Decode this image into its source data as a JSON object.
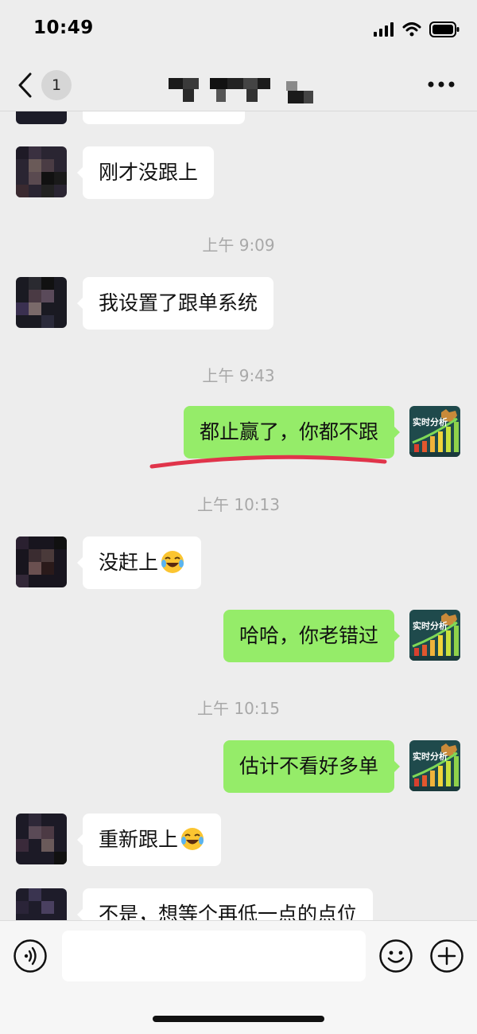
{
  "status_bar": {
    "time": "10:49",
    "icons": [
      "signal-icon",
      "wifi-icon",
      "battery-icon"
    ]
  },
  "nav": {
    "back_icon": "chevron-left-icon",
    "unread_count": "1",
    "more_icon": "more-dots-icon"
  },
  "messages": [
    {
      "side": "left",
      "text": "刚才没跟上"
    },
    {
      "type": "timestamp",
      "text": "上午 9:09"
    },
    {
      "side": "left",
      "text": "我设置了跟单系统"
    },
    {
      "type": "timestamp",
      "text": "上午 9:43"
    },
    {
      "side": "right",
      "text": "都止赢了，你都不跟"
    },
    {
      "type": "timestamp",
      "text": "上午 10:13"
    },
    {
      "side": "left",
      "text": "没赶上",
      "emoji": "laughing-crying-emoji"
    },
    {
      "side": "right",
      "text": "哈哈，你老错过"
    },
    {
      "type": "timestamp",
      "text": "上午 10:15"
    },
    {
      "side": "right",
      "text": "估计不看好多单"
    },
    {
      "side": "left",
      "text": "重新跟上",
      "emoji": "laughing-crying-emoji"
    },
    {
      "side": "left",
      "text": "不是，想等个再低一点的点位"
    }
  ],
  "my_avatar": {
    "caption": "实时分析"
  },
  "colors": {
    "background": "#ededed",
    "bubble_self": "#95ec69",
    "bubble_other": "#ffffff",
    "annotation_underline": "#e0344a",
    "timestamp": "#a8a8a8"
  },
  "input_bar": {
    "voice_icon": "voice-icon",
    "emoji_icon": "smiley-icon",
    "plus_icon": "plus-circle-icon",
    "value": ""
  }
}
